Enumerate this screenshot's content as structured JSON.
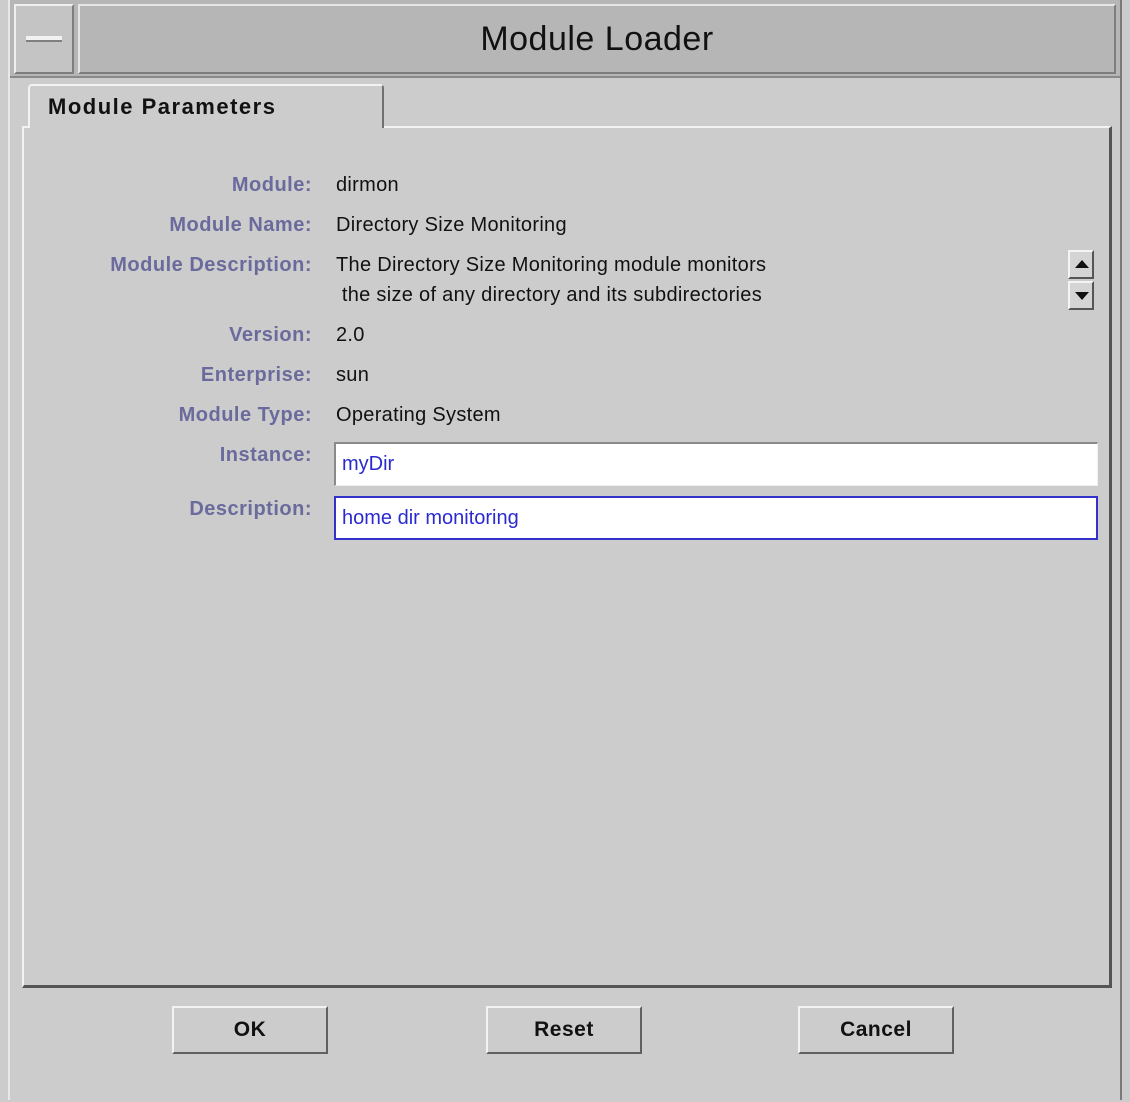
{
  "window": {
    "title": "Module Loader"
  },
  "tabs": [
    {
      "label": "Module Parameters"
    }
  ],
  "fields": {
    "module": {
      "label": "Module:",
      "value": "dirmon"
    },
    "module_name": {
      "label": "Module Name:",
      "value": "Directory Size Monitoring"
    },
    "module_description": {
      "label": "Module Description:",
      "line1": "The Directory Size Monitoring module monitors",
      "line2": " the size of any directory and its subdirectories"
    },
    "version": {
      "label": "Version:",
      "value": "2.0"
    },
    "enterprise": {
      "label": "Enterprise:",
      "value": "sun"
    },
    "module_type": {
      "label": "Module Type:",
      "value": "Operating System"
    },
    "instance": {
      "label": "Instance:",
      "value": "myDir"
    },
    "description": {
      "label": "Description:",
      "value": "home dir monitoring"
    }
  },
  "icons": {
    "window_menu": "window-menu-icon",
    "scroll_up": "arrow-up-icon",
    "scroll_down": "arrow-down-icon"
  },
  "buttons": {
    "ok": "OK",
    "reset": "Reset",
    "cancel": "Cancel"
  },
  "colors": {
    "label": "#6a6a9c",
    "input_text": "#2a2ad0",
    "focus_border": "#3333cc",
    "background": "#cccccc"
  }
}
